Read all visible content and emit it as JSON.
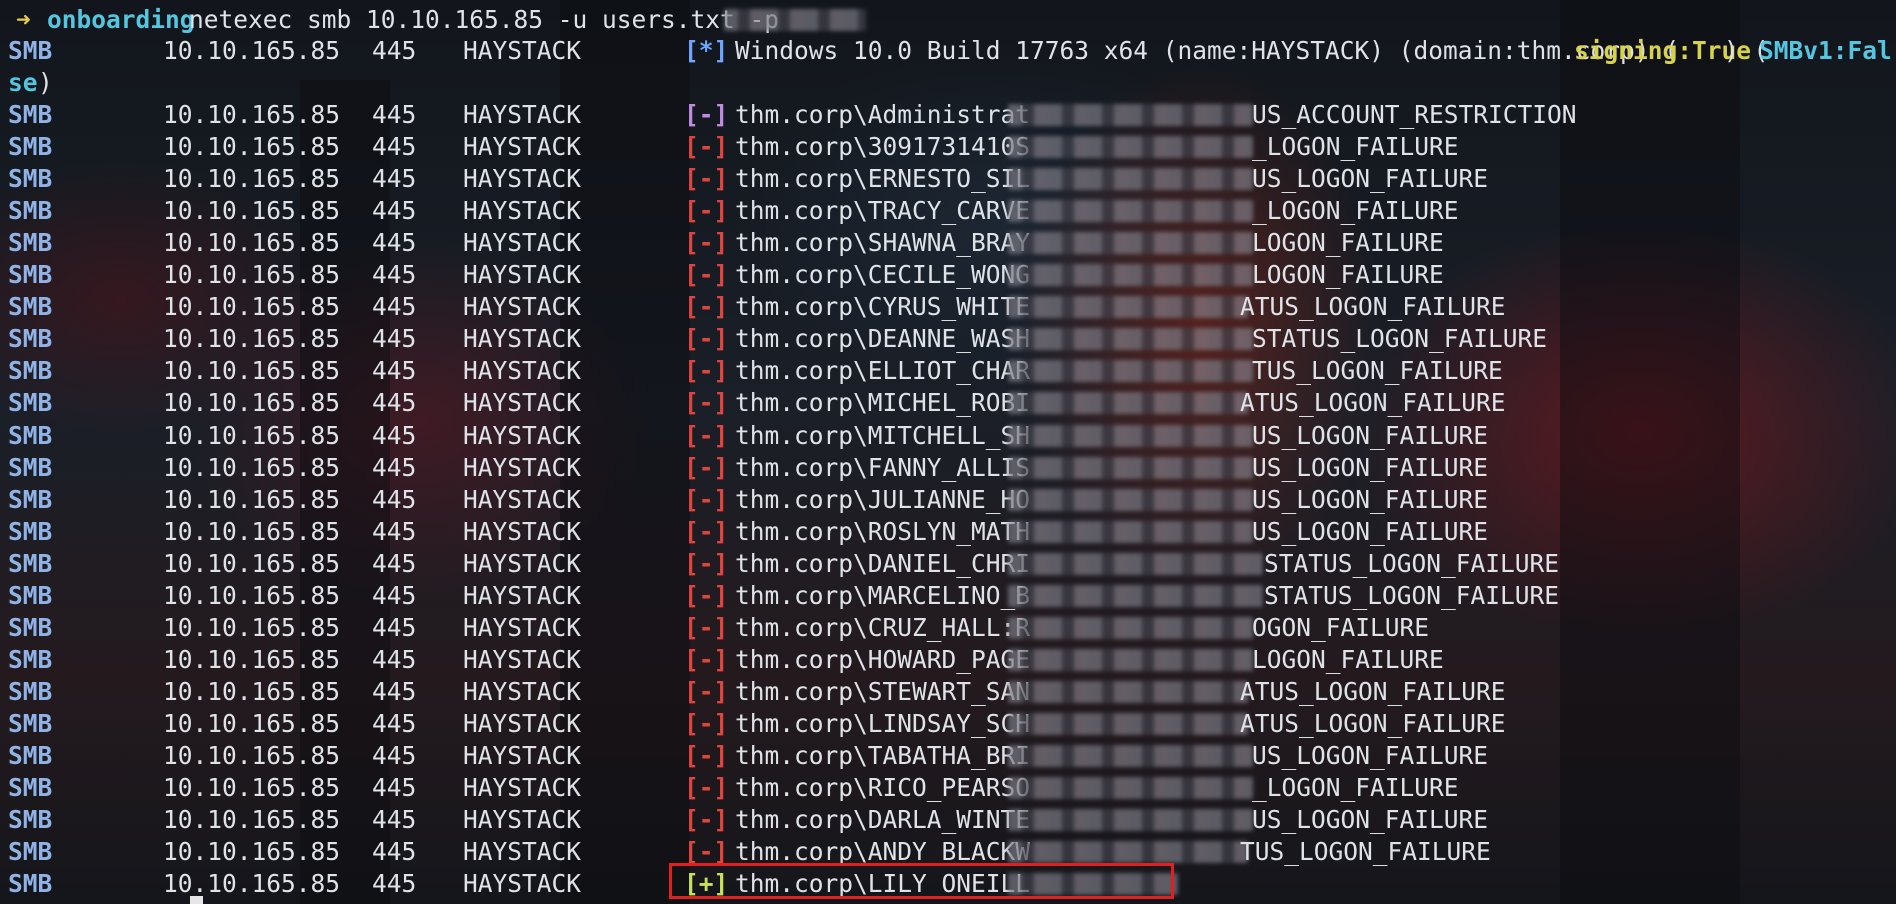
{
  "prompt": {
    "arrow": "➜",
    "dir": "onboarding",
    "command": "netexec smb 10.10.165.85 -u users.txt -p"
  },
  "info_line": {
    "proto": "SMB",
    "ip": "10.10.165.85",
    "port": "445",
    "host": "HAYSTACK",
    "status": "[*]",
    "text": "Windows 10.0 Build 17763 x64 (name:HAYSTACK) (domain:thm.corp) (",
    "signing": "signing:True",
    "mid": ") (",
    "smbv1": "SMBv1:Fal",
    "wrap": "se",
    "wrap_paren": ")"
  },
  "rows": [
    {
      "proto": "SMB",
      "ip": "10.10.165.85",
      "port": "445",
      "host": "HAYSTACK",
      "status": "[-]",
      "kind": "admin",
      "user": "thm.corp\\Administrat",
      "result": "US_ACCOUNT_RESTRICTION"
    },
    {
      "proto": "SMB",
      "ip": "10.10.165.85",
      "port": "445",
      "host": "HAYSTACK",
      "status": "[-]",
      "kind": "fail",
      "user": "thm.corp\\3091731410S",
      "result": "_LOGON_FAILURE"
    },
    {
      "proto": "SMB",
      "ip": "10.10.165.85",
      "port": "445",
      "host": "HAYSTACK",
      "status": "[-]",
      "kind": "fail",
      "user": "thm.corp\\ERNESTO_SIL",
      "result": "US_LOGON_FAILURE"
    },
    {
      "proto": "SMB",
      "ip": "10.10.165.85",
      "port": "445",
      "host": "HAYSTACK",
      "status": "[-]",
      "kind": "fail",
      "user": "thm.corp\\TRACY_CARVE",
      "result": "_LOGON_FAILURE"
    },
    {
      "proto": "SMB",
      "ip": "10.10.165.85",
      "port": "445",
      "host": "HAYSTACK",
      "status": "[-]",
      "kind": "fail",
      "user": "thm.corp\\SHAWNA_BRAY",
      "result": "LOGON_FAILURE"
    },
    {
      "proto": "SMB",
      "ip": "10.10.165.85",
      "port": "445",
      "host": "HAYSTACK",
      "status": "[-]",
      "kind": "fail",
      "user": "thm.corp\\CECILE_WONG",
      "result": "LOGON_FAILURE"
    },
    {
      "proto": "SMB",
      "ip": "10.10.165.85",
      "port": "445",
      "host": "HAYSTACK",
      "status": "[-]",
      "kind": "fail",
      "user": "thm.corp\\CYRUS_WHITE",
      "result": "ATUS_LOGON_FAILURE"
    },
    {
      "proto": "SMB",
      "ip": "10.10.165.85",
      "port": "445",
      "host": "HAYSTACK",
      "status": "[-]",
      "kind": "fail",
      "user": "thm.corp\\DEANNE_WASH",
      "result": "STATUS_LOGON_FAILURE"
    },
    {
      "proto": "SMB",
      "ip": "10.10.165.85",
      "port": "445",
      "host": "HAYSTACK",
      "status": "[-]",
      "kind": "fail",
      "user": "thm.corp\\ELLIOT_CHAR",
      "result": "TUS_LOGON_FAILURE"
    },
    {
      "proto": "SMB",
      "ip": "10.10.165.85",
      "port": "445",
      "host": "HAYSTACK",
      "status": "[-]",
      "kind": "fail",
      "user": "thm.corp\\MICHEL_ROBI",
      "result": "ATUS_LOGON_FAILURE"
    },
    {
      "proto": "SMB",
      "ip": "10.10.165.85",
      "port": "445",
      "host": "HAYSTACK",
      "status": "[-]",
      "kind": "fail",
      "user": "thm.corp\\MITCHELL_SH",
      "result": "US_LOGON_FAILURE"
    },
    {
      "proto": "SMB",
      "ip": "10.10.165.85",
      "port": "445",
      "host": "HAYSTACK",
      "status": "[-]",
      "kind": "fail",
      "user": "thm.corp\\FANNY_ALLIS",
      "result": "US_LOGON_FAILURE"
    },
    {
      "proto": "SMB",
      "ip": "10.10.165.85",
      "port": "445",
      "host": "HAYSTACK",
      "status": "[-]",
      "kind": "fail",
      "user": "thm.corp\\JULIANNE_HO",
      "result": "US_LOGON_FAILURE"
    },
    {
      "proto": "SMB",
      "ip": "10.10.165.85",
      "port": "445",
      "host": "HAYSTACK",
      "status": "[-]",
      "kind": "fail",
      "user": "thm.corp\\ROSLYN_MATH",
      "result": "US_LOGON_FAILURE"
    },
    {
      "proto": "SMB",
      "ip": "10.10.165.85",
      "port": "445",
      "host": "HAYSTACK",
      "status": "[-]",
      "kind": "fail",
      "user": "thm.corp\\DANIEL_CHRI",
      "result": "STATUS_LOGON_FAILURE"
    },
    {
      "proto": "SMB",
      "ip": "10.10.165.85",
      "port": "445",
      "host": "HAYSTACK",
      "status": "[-]",
      "kind": "fail",
      "user": "thm.corp\\MARCELINO_B",
      "result": "STATUS_LOGON_FAILURE"
    },
    {
      "proto": "SMB",
      "ip": "10.10.165.85",
      "port": "445",
      "host": "HAYSTACK",
      "status": "[-]",
      "kind": "fail",
      "user": "thm.corp\\CRUZ_HALL:R",
      "result": "OGON_FAILURE"
    },
    {
      "proto": "SMB",
      "ip": "10.10.165.85",
      "port": "445",
      "host": "HAYSTACK",
      "status": "[-]",
      "kind": "fail",
      "user": "thm.corp\\HOWARD_PAGE",
      "result": "LOGON_FAILURE"
    },
    {
      "proto": "SMB",
      "ip": "10.10.165.85",
      "port": "445",
      "host": "HAYSTACK",
      "status": "[-]",
      "kind": "fail",
      "user": "thm.corp\\STEWART_SAN",
      "result": "ATUS_LOGON_FAILURE"
    },
    {
      "proto": "SMB",
      "ip": "10.10.165.85",
      "port": "445",
      "host": "HAYSTACK",
      "status": "[-]",
      "kind": "fail",
      "user": "thm.corp\\LINDSAY_SCH",
      "result": "ATUS_LOGON_FAILURE"
    },
    {
      "proto": "SMB",
      "ip": "10.10.165.85",
      "port": "445",
      "host": "HAYSTACK",
      "status": "[-]",
      "kind": "fail",
      "user": "thm.corp\\TABATHA_BRI",
      "result": "US_LOGON_FAILURE"
    },
    {
      "proto": "SMB",
      "ip": "10.10.165.85",
      "port": "445",
      "host": "HAYSTACK",
      "status": "[-]",
      "kind": "fail",
      "user": "thm.corp\\RICO_PEARSO",
      "result": "_LOGON_FAILURE"
    },
    {
      "proto": "SMB",
      "ip": "10.10.165.85",
      "port": "445",
      "host": "HAYSTACK",
      "status": "[-]",
      "kind": "fail",
      "user": "thm.corp\\DARLA_WINTE",
      "result": "US_LOGON_FAILURE"
    },
    {
      "proto": "SMB",
      "ip": "10.10.165.85",
      "port": "445",
      "host": "HAYSTACK",
      "status": "[-]",
      "kind": "fail",
      "user": "thm.corp\\ANDY_BLACKW",
      "result": "TUS_LOGON_FAILURE"
    },
    {
      "proto": "SMB",
      "ip": "10.10.165.85",
      "port": "445",
      "host": "HAYSTACK",
      "status": "[+]",
      "kind": "ok",
      "user": "thm.corp\\LILY_ONEILL",
      "result": ""
    }
  ]
}
